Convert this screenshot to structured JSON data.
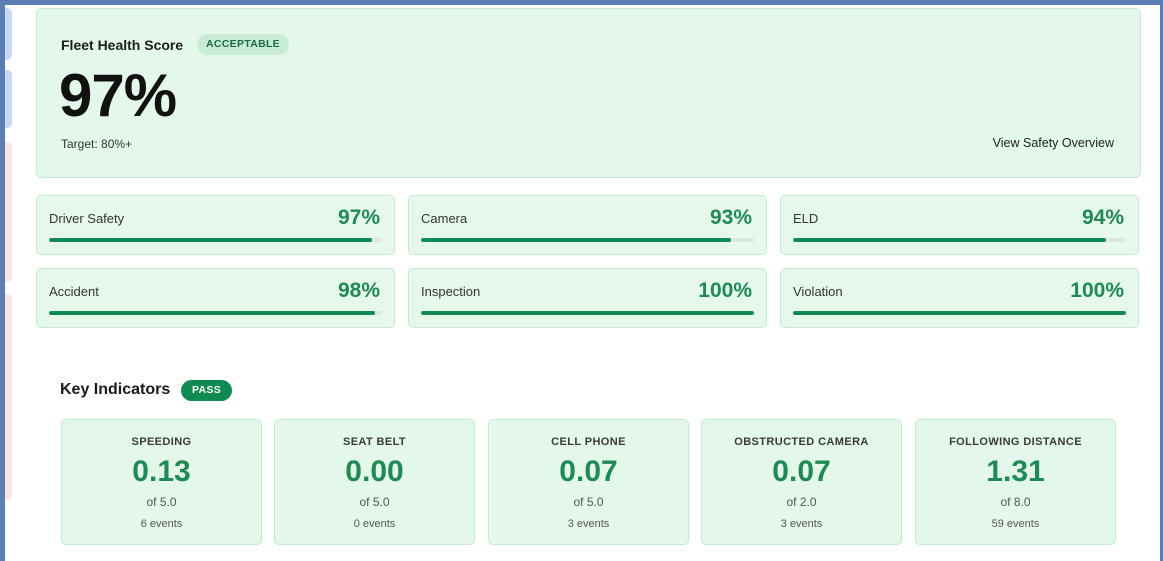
{
  "colors": {
    "accent_green": "#1e8a55",
    "progress_fill": "#0f8a52",
    "card_bg": "#e3f7ea",
    "frame": "#5b7fb5"
  },
  "hero": {
    "title": "Fleet Health Score",
    "badge": "ACCEPTABLE",
    "score": "97%",
    "target": "Target: 80%+",
    "link": "View Safety Overview"
  },
  "metrics": [
    {
      "label": "Driver Safety",
      "value": "97%",
      "progress": 0.97
    },
    {
      "label": "Camera",
      "value": "93%",
      "progress": 0.93
    },
    {
      "label": "ELD",
      "value": "94%",
      "progress": 0.94
    },
    {
      "label": "Accident",
      "value": "98%",
      "progress": 0.98
    },
    {
      "label": "Inspection",
      "value": "100%",
      "progress": 1.0
    },
    {
      "label": "Violation",
      "value": "100%",
      "progress": 1.0
    }
  ],
  "key_indicators": {
    "title": "Key Indicators",
    "badge": "PASS",
    "items": [
      {
        "label": "SPEEDING",
        "value": "0.13",
        "of": "of 5.0",
        "events": "6 events"
      },
      {
        "label": "SEAT BELT",
        "value": "0.00",
        "of": "of 5.0",
        "events": "0 events"
      },
      {
        "label": "CELL PHONE",
        "value": "0.07",
        "of": "of 5.0",
        "events": "3 events"
      },
      {
        "label": "OBSTRUCTED CAMERA",
        "value": "0.07",
        "of": "of 2.0",
        "events": "3 events"
      },
      {
        "label": "FOLLOWING DISTANCE",
        "value": "1.31",
        "of": "of 8.0",
        "events": "59 events"
      }
    ]
  }
}
